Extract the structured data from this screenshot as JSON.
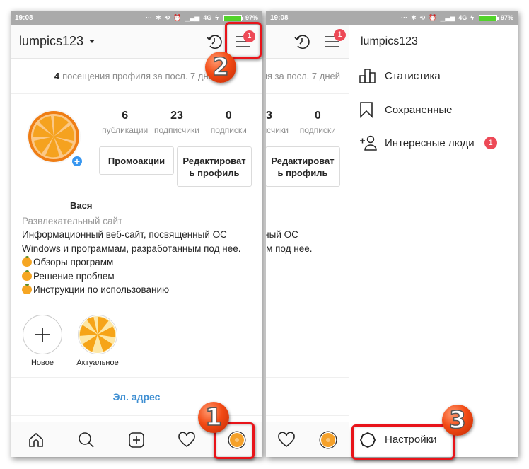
{
  "statusbar": {
    "time": "19:08",
    "network": "4G",
    "battery": "97%",
    "icons": [
      "dots-icon",
      "bluetooth-icon",
      "rotation-lock-icon",
      "alarm-icon",
      "data-arrows-icon",
      "signal-icon",
      "charging-icon",
      "battery-icon"
    ]
  },
  "profile": {
    "username": "lumpics123",
    "visits_count": "4",
    "visits_text": "посещения профиля за посл. 7 дней",
    "stats": [
      {
        "value": "6",
        "label": "публикации"
      },
      {
        "value": "23",
        "label": "подписчики"
      },
      {
        "value": "0",
        "label": "подписки"
      }
    ],
    "promo_button": "Промоакции",
    "edit_button": "Редактировать профиль",
    "name": "Вася",
    "category": "Развлекательный сайт",
    "bio_line1": "Информационный веб-сайт, посвященный ОС",
    "bio_line2": "Windows и программам, разработанным под нее.",
    "bio_list": [
      "Обзоры программ",
      "Решение проблем",
      "Инструкции по использованию"
    ],
    "highlights": [
      {
        "label": "Новое",
        "icon": "plus-icon"
      },
      {
        "label": "Актуальное",
        "icon": "orange-slice-image"
      }
    ],
    "email_link": "Эл. адрес",
    "menu_badge": "1"
  },
  "tabbar": [
    "home-icon",
    "search-icon",
    "add-post-icon",
    "activity-heart-icon",
    "profile-avatar-icon"
  ],
  "drawer": {
    "title": "lumpics123",
    "items": [
      {
        "label": "Статистика",
        "icon": "bar-chart-icon"
      },
      {
        "label": "Сохраненные",
        "icon": "bookmark-icon"
      },
      {
        "label": "Интересные люди",
        "icon": "add-person-icon",
        "badge": "1"
      }
    ],
    "settings": "Настройки"
  },
  "annotations": {
    "step1": "1",
    "step2": "2",
    "step3": "3",
    "highlight_color": "#e8141a"
  },
  "colors": {
    "badge": "#ed4956",
    "link": "#3f8fd2",
    "plus_badge": "#3897f0",
    "statusbar": "#aaaaaa"
  }
}
